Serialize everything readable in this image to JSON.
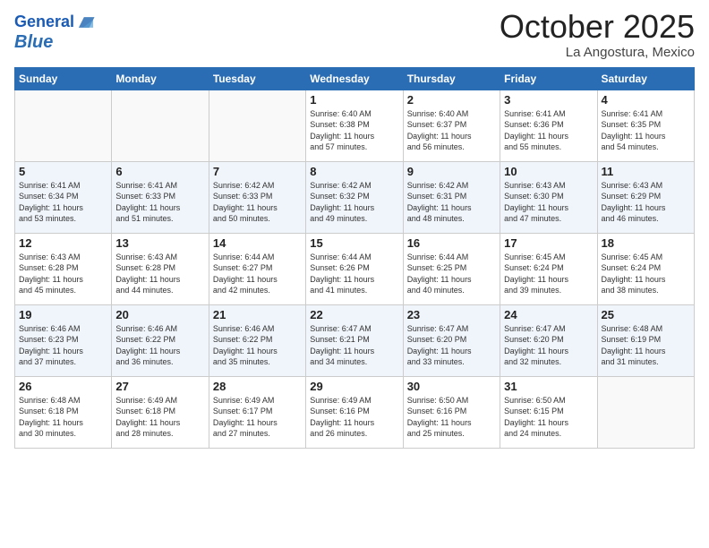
{
  "header": {
    "logo_line1": "General",
    "logo_line2": "Blue",
    "month": "October 2025",
    "location": "La Angostura, Mexico"
  },
  "weekdays": [
    "Sunday",
    "Monday",
    "Tuesday",
    "Wednesday",
    "Thursday",
    "Friday",
    "Saturday"
  ],
  "weeks": [
    [
      {
        "day": "",
        "info": ""
      },
      {
        "day": "",
        "info": ""
      },
      {
        "day": "",
        "info": ""
      },
      {
        "day": "1",
        "info": "Sunrise: 6:40 AM\nSunset: 6:38 PM\nDaylight: 11 hours\nand 57 minutes."
      },
      {
        "day": "2",
        "info": "Sunrise: 6:40 AM\nSunset: 6:37 PM\nDaylight: 11 hours\nand 56 minutes."
      },
      {
        "day": "3",
        "info": "Sunrise: 6:41 AM\nSunset: 6:36 PM\nDaylight: 11 hours\nand 55 minutes."
      },
      {
        "day": "4",
        "info": "Sunrise: 6:41 AM\nSunset: 6:35 PM\nDaylight: 11 hours\nand 54 minutes."
      }
    ],
    [
      {
        "day": "5",
        "info": "Sunrise: 6:41 AM\nSunset: 6:34 PM\nDaylight: 11 hours\nand 53 minutes."
      },
      {
        "day": "6",
        "info": "Sunrise: 6:41 AM\nSunset: 6:33 PM\nDaylight: 11 hours\nand 51 minutes."
      },
      {
        "day": "7",
        "info": "Sunrise: 6:42 AM\nSunset: 6:33 PM\nDaylight: 11 hours\nand 50 minutes."
      },
      {
        "day": "8",
        "info": "Sunrise: 6:42 AM\nSunset: 6:32 PM\nDaylight: 11 hours\nand 49 minutes."
      },
      {
        "day": "9",
        "info": "Sunrise: 6:42 AM\nSunset: 6:31 PM\nDaylight: 11 hours\nand 48 minutes."
      },
      {
        "day": "10",
        "info": "Sunrise: 6:43 AM\nSunset: 6:30 PM\nDaylight: 11 hours\nand 47 minutes."
      },
      {
        "day": "11",
        "info": "Sunrise: 6:43 AM\nSunset: 6:29 PM\nDaylight: 11 hours\nand 46 minutes."
      }
    ],
    [
      {
        "day": "12",
        "info": "Sunrise: 6:43 AM\nSunset: 6:28 PM\nDaylight: 11 hours\nand 45 minutes."
      },
      {
        "day": "13",
        "info": "Sunrise: 6:43 AM\nSunset: 6:28 PM\nDaylight: 11 hours\nand 44 minutes."
      },
      {
        "day": "14",
        "info": "Sunrise: 6:44 AM\nSunset: 6:27 PM\nDaylight: 11 hours\nand 42 minutes."
      },
      {
        "day": "15",
        "info": "Sunrise: 6:44 AM\nSunset: 6:26 PM\nDaylight: 11 hours\nand 41 minutes."
      },
      {
        "day": "16",
        "info": "Sunrise: 6:44 AM\nSunset: 6:25 PM\nDaylight: 11 hours\nand 40 minutes."
      },
      {
        "day": "17",
        "info": "Sunrise: 6:45 AM\nSunset: 6:24 PM\nDaylight: 11 hours\nand 39 minutes."
      },
      {
        "day": "18",
        "info": "Sunrise: 6:45 AM\nSunset: 6:24 PM\nDaylight: 11 hours\nand 38 minutes."
      }
    ],
    [
      {
        "day": "19",
        "info": "Sunrise: 6:46 AM\nSunset: 6:23 PM\nDaylight: 11 hours\nand 37 minutes."
      },
      {
        "day": "20",
        "info": "Sunrise: 6:46 AM\nSunset: 6:22 PM\nDaylight: 11 hours\nand 36 minutes."
      },
      {
        "day": "21",
        "info": "Sunrise: 6:46 AM\nSunset: 6:22 PM\nDaylight: 11 hours\nand 35 minutes."
      },
      {
        "day": "22",
        "info": "Sunrise: 6:47 AM\nSunset: 6:21 PM\nDaylight: 11 hours\nand 34 minutes."
      },
      {
        "day": "23",
        "info": "Sunrise: 6:47 AM\nSunset: 6:20 PM\nDaylight: 11 hours\nand 33 minutes."
      },
      {
        "day": "24",
        "info": "Sunrise: 6:47 AM\nSunset: 6:20 PM\nDaylight: 11 hours\nand 32 minutes."
      },
      {
        "day": "25",
        "info": "Sunrise: 6:48 AM\nSunset: 6:19 PM\nDaylight: 11 hours\nand 31 minutes."
      }
    ],
    [
      {
        "day": "26",
        "info": "Sunrise: 6:48 AM\nSunset: 6:18 PM\nDaylight: 11 hours\nand 30 minutes."
      },
      {
        "day": "27",
        "info": "Sunrise: 6:49 AM\nSunset: 6:18 PM\nDaylight: 11 hours\nand 28 minutes."
      },
      {
        "day": "28",
        "info": "Sunrise: 6:49 AM\nSunset: 6:17 PM\nDaylight: 11 hours\nand 27 minutes."
      },
      {
        "day": "29",
        "info": "Sunrise: 6:49 AM\nSunset: 6:16 PM\nDaylight: 11 hours\nand 26 minutes."
      },
      {
        "day": "30",
        "info": "Sunrise: 6:50 AM\nSunset: 6:16 PM\nDaylight: 11 hours\nand 25 minutes."
      },
      {
        "day": "31",
        "info": "Sunrise: 6:50 AM\nSunset: 6:15 PM\nDaylight: 11 hours\nand 24 minutes."
      },
      {
        "day": "",
        "info": ""
      }
    ]
  ]
}
